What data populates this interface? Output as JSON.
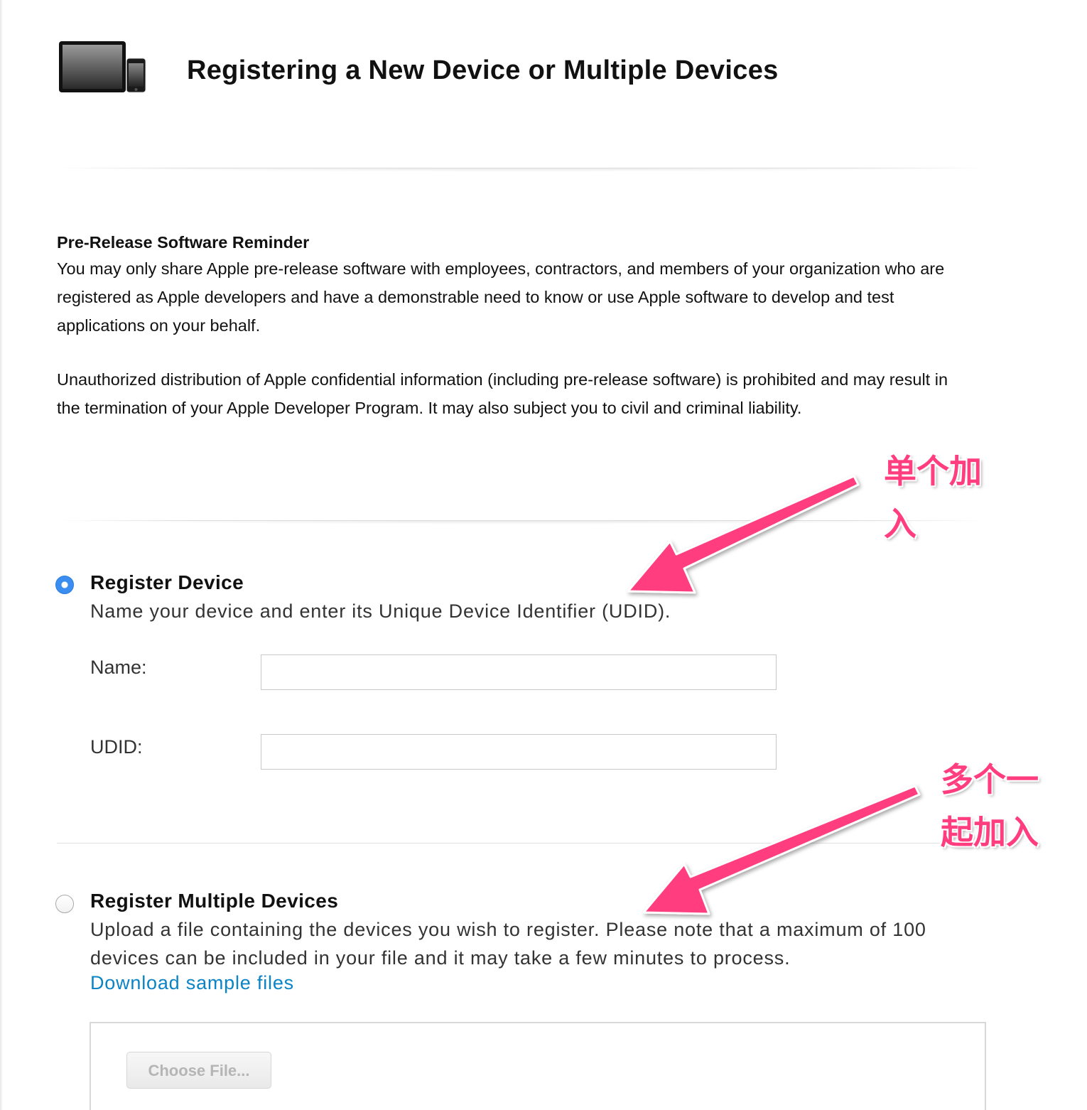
{
  "header": {
    "title": "Registering a New Device or Multiple Devices",
    "icon": "ipad-iphone-icon"
  },
  "reminder": {
    "heading": "Pre-Release Software Reminder",
    "paragraph1": "You may only share Apple pre-release software with employees, contractors, and members of your organization who are registered as Apple developers and have a demonstrable need to know or use Apple software to develop and test applications on your behalf.",
    "paragraph2": "Unauthorized distribution of Apple confidential information (including pre-release software) is prohibited and may result in the termination of your Apple Developer Program. It may also subject you to civil and criminal liability."
  },
  "register_device": {
    "selected": true,
    "title": "Register Device",
    "description": "Name your device and enter its Unique Device Identifier (UDID).",
    "name_label": "Name:",
    "name_value": "",
    "udid_label": "UDID:",
    "udid_value": ""
  },
  "register_multiple": {
    "selected": false,
    "title": "Register Multiple Devices",
    "description": "Upload a file containing the devices you wish to register. Please note that a maximum of 100 devices can be included in your file and it may take a few minutes to process.",
    "download_link": "Download sample files",
    "choose_file_label": "Choose File..."
  },
  "annotations": {
    "single_add": "单个加入",
    "multiple_add": "多个一起加入",
    "color": "#ff3d7f"
  },
  "colors": {
    "link": "#0a84c6",
    "radio_selected": "#3b8ef0"
  }
}
